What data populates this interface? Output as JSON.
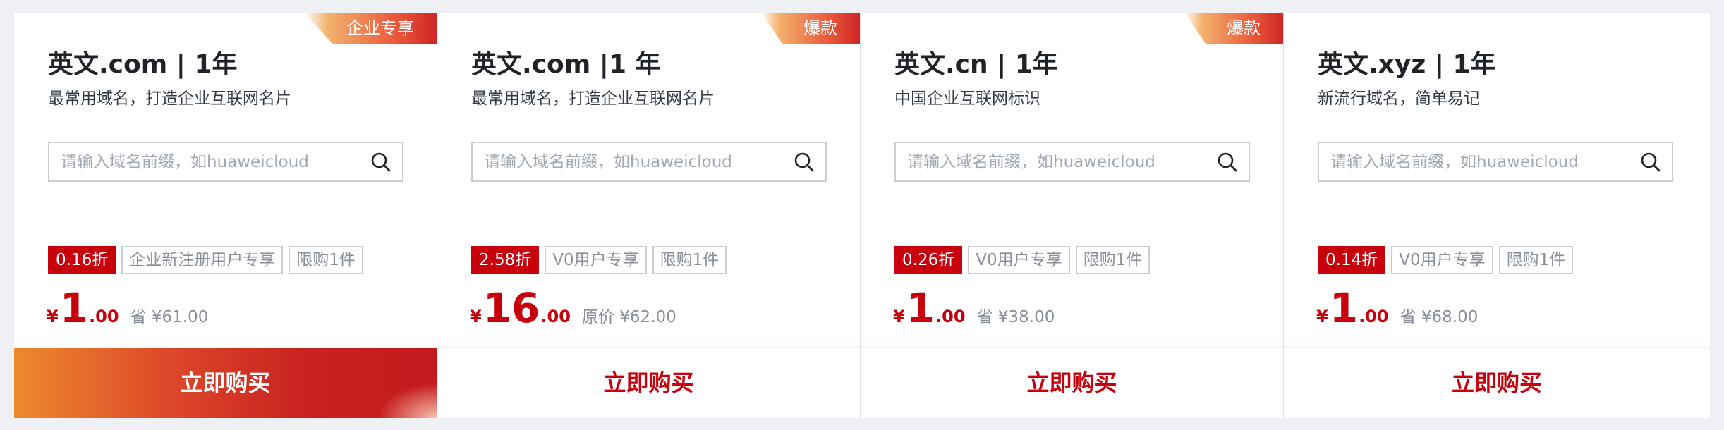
{
  "cards": [
    {
      "badge": "企业专享",
      "title": "英文.com | 1年",
      "subtitle": "最常用域名，打造企业互联网名片",
      "search_placeholder": "请输入域名前缀，如huaweicloud",
      "discount": "0.16折",
      "tag1": "企业新注册用户专享",
      "tag2": "限购1件",
      "currency": "¥",
      "price_int": "1",
      "price_dec": ".00",
      "price_note": "省 ¥61.00",
      "buy_label": "立即购买"
    },
    {
      "badge": "爆款",
      "title": "英文.com |1 年",
      "subtitle": "最常用域名，打造企业互联网名片",
      "search_placeholder": "请输入域名前缀，如huaweicloud",
      "discount": "2.58折",
      "tag1": "V0用户专享",
      "tag2": "限购1件",
      "currency": "¥",
      "price_int": "16",
      "price_dec": ".00",
      "price_note": "原价 ¥62.00",
      "buy_label": "立即购买"
    },
    {
      "badge": "爆款",
      "title": "英文.cn | 1年",
      "subtitle": "中国企业互联网标识",
      "search_placeholder": "请输入域名前缀，如huaweicloud",
      "discount": "0.26折",
      "tag1": "V0用户专享",
      "tag2": "限购1件",
      "currency": "¥",
      "price_int": "1",
      "price_dec": ".00",
      "price_note": "省 ¥38.00",
      "buy_label": "立即购买"
    },
    {
      "badge": "",
      "title": "英文.xyz | 1年",
      "subtitle": "新流行域名，简单易记",
      "search_placeholder": "请输入域名前缀，如huaweicloud",
      "discount": "0.14折",
      "tag1": "V0用户专享",
      "tag2": "限购1件",
      "currency": "¥",
      "price_int": "1",
      "price_dec": ".00",
      "price_note": "省 ¥68.00",
      "buy_label": "立即购买"
    }
  ],
  "colors": {
    "accent": "#c7000b",
    "badge_gradient_start": "#f3b26e",
    "badge_gradient_end": "#cf2525"
  },
  "icons": {
    "search": "search-icon"
  }
}
